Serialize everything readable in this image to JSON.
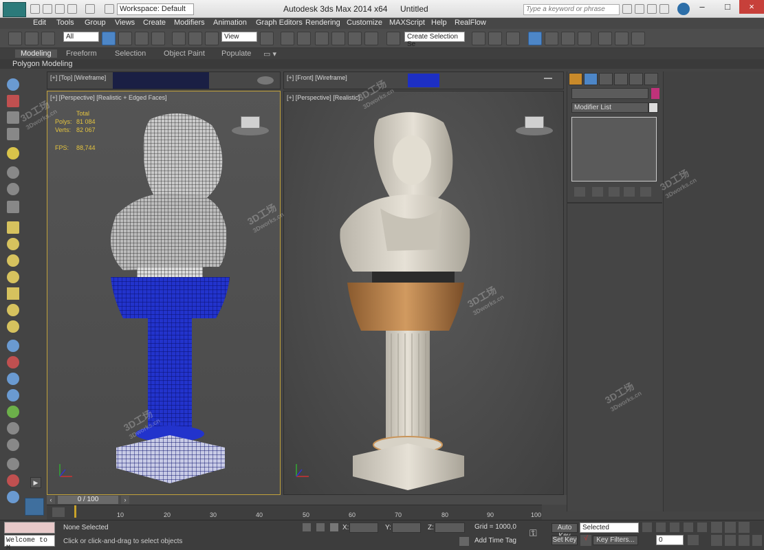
{
  "window": {
    "title": "Autodesk 3ds Max  2014 x64",
    "document": "Untitled",
    "workspace": "Workspace: Default",
    "search_placeholder": "Type a keyword or phrase"
  },
  "menu": [
    "Edit",
    "Tools",
    "Group",
    "Views",
    "Create",
    "Modifiers",
    "Animation",
    "Graph Editors",
    "Rendering",
    "Customize",
    "MAXScript",
    "Help",
    "RealFlow"
  ],
  "toolbar": {
    "selection_filter": "All",
    "reference_coord": "View",
    "named_selection": "Create Selection Se"
  },
  "ribbon": {
    "tabs": [
      "Modeling",
      "Freeform",
      "Selection",
      "Object Paint",
      "Populate"
    ],
    "active_tab": "Modeling",
    "panel": "Polygon Modeling"
  },
  "viewports": {
    "top": "[+] [Top] [Wireframe]",
    "front": "[+] [Front] [Wireframe]",
    "perspective_edged": "[+] [Perspective] [Realistic + Edged Faces]",
    "perspective_realistic": "[+] [Perspective] [Realistic]"
  },
  "stats": {
    "total_label": "Total",
    "polys_label": "Polys:",
    "polys": "81 084",
    "verts_label": "Verts:",
    "verts": "82 067",
    "fps_label": "FPS:",
    "fps": "88,744"
  },
  "command_panel": {
    "modifier_list": "Modifier List"
  },
  "timeline": {
    "frame": "0 / 100",
    "ticks": [
      "10",
      "20",
      "30",
      "40",
      "50",
      "60",
      "70",
      "80",
      "90",
      "100"
    ]
  },
  "status": {
    "maxscript": "Welcome to M",
    "selection": "None Selected",
    "prompt": "Click or click-and-drag to select objects",
    "x_label": "X:",
    "y_label": "Y:",
    "z_label": "Z:",
    "grid": "Grid = 1000,0",
    "add_time_tag": "Add Time Tag",
    "auto_key": "Auto Key",
    "set_key": "Set Key",
    "key_mode": "Selected",
    "key_filters": "Key Filters...",
    "frame_field": "0"
  },
  "watermark": {
    "cn": "3D工场",
    "site": "3Dworks.cn"
  },
  "colors": {
    "accent": "#4d86c7",
    "stats_text": "#e4c43f",
    "viewport_bg": "#4f4f4f",
    "wire_blue": "#2233cc",
    "bust_realistic": "#d9d4c8",
    "capital_wood": "#c8945a"
  }
}
